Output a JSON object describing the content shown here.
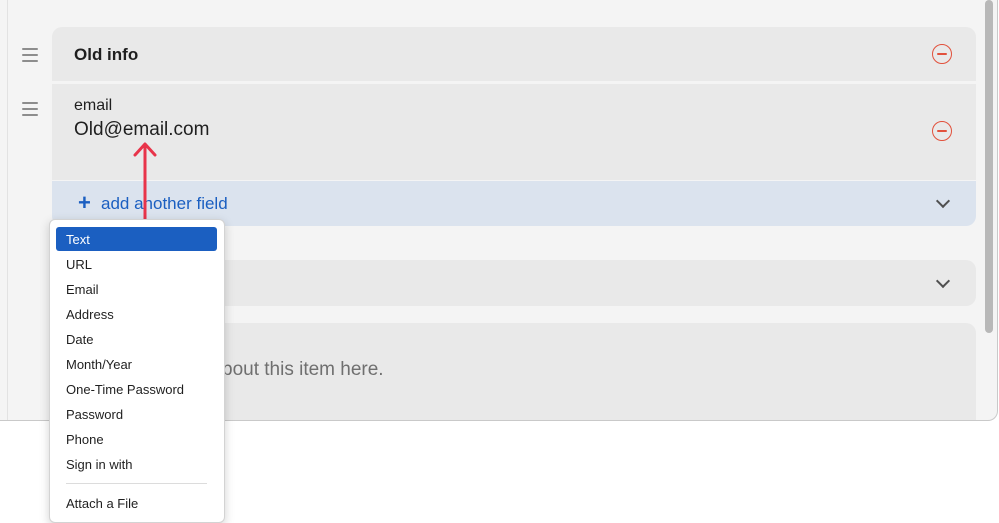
{
  "section": {
    "title": "Old info"
  },
  "field": {
    "label": "email",
    "value": "Old@email.com"
  },
  "add_field": {
    "icon": "+",
    "label": "add another field"
  },
  "notes": {
    "placeholder_fragment": "bout this item here."
  },
  "menu": {
    "items": [
      {
        "label": "Text",
        "selected": true
      },
      {
        "label": "URL"
      },
      {
        "label": "Email"
      },
      {
        "label": "Address"
      },
      {
        "label": "Date"
      },
      {
        "label": "Month/Year"
      },
      {
        "label": "One-Time Password"
      },
      {
        "label": "Password"
      },
      {
        "label": "Phone"
      },
      {
        "label": "Sign in with"
      }
    ],
    "footer_item": {
      "label": "Attach a File"
    }
  },
  "colors": {
    "accent": "#1b5fc1",
    "remove": "#e2513c",
    "annotation_arrow": "#e8344a"
  },
  "icons": {
    "drag": "drag-handle-icon",
    "remove": "minus-circle-icon",
    "add": "plus-icon",
    "expand": "chevron-down-icon",
    "annotation": "arrow-up-icon"
  }
}
